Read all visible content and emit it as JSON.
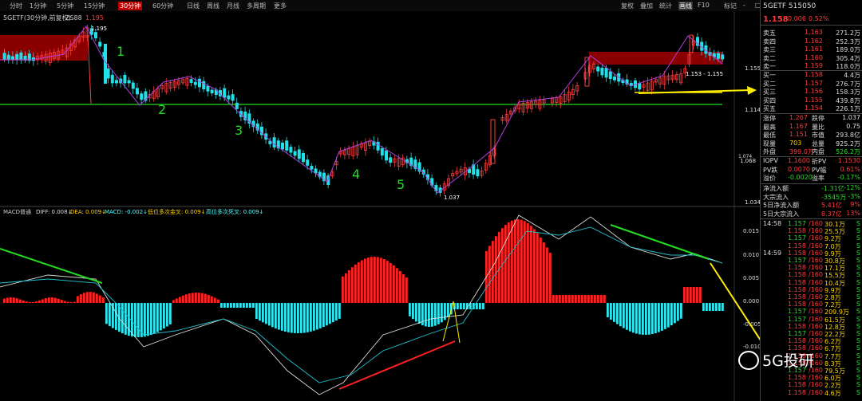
{
  "toolbar": {
    "periods": [
      "分时",
      "1分钟",
      "5分钟",
      "15分钟",
      "30分钟",
      "60分钟",
      "日线",
      "周线",
      "月线",
      "多周期",
      "更多"
    ],
    "active_period": "30分钟",
    "right_items": [
      "复权",
      "叠加",
      "统计",
      "画线",
      "F10",
      "标记",
      "-",
      "□"
    ],
    "right_active": "画线"
  },
  "chart": {
    "title": "5GETF(30分钟,前复权)",
    "indicator": "ZS88",
    "title_value": "1.195",
    "price_labels": {
      "high": "1.195",
      "low": "1.037",
      "range": "1.153 - 1.155",
      "axis_1": "1.155",
      "axis_2": "1.114",
      "axis_3": "1.074",
      "axis_4": "1.068",
      "axis_5": "1.034"
    },
    "wave_labels": [
      "1",
      "2",
      "3",
      "4",
      "5"
    ],
    "macd_header": {
      "name": "MACD普通",
      "diff": "DIFF: 0.008↓",
      "dea": "DEA: 0.009↓",
      "macd": "MACD: -0.002↓",
      "l1": "低位多次金叉: 0.009↓",
      "l2": "高位多次死叉: 0.009↓"
    },
    "macd_axis": [
      "0.015",
      "0.010",
      "0.005",
      "0.000",
      "-0.005",
      "-0.010"
    ]
  },
  "quote": {
    "code": "5GETF 515050",
    "price": "1.158",
    "change": "0.006",
    "pct": "0.52%",
    "asks": [
      {
        "label": "卖五",
        "price": "1.163",
        "vol": "271.2万"
      },
      {
        "label": "卖四",
        "price": "1.162",
        "vol": "252.3万"
      },
      {
        "label": "卖三",
        "price": "1.161",
        "vol": "189.0万"
      },
      {
        "label": "卖二",
        "price": "1.160",
        "vol": "305.4万"
      },
      {
        "label": "卖一",
        "price": "1.159",
        "vol": "118.0万"
      }
    ],
    "bids": [
      {
        "label": "买一",
        "price": "1.158",
        "vol": "4.4万"
      },
      {
        "label": "买二",
        "price": "1.157",
        "vol": "276.7万"
      },
      {
        "label": "买三",
        "price": "1.156",
        "vol": "158.3万"
      },
      {
        "label": "买四",
        "price": "1.155",
        "vol": "439.8万"
      },
      {
        "label": "买五",
        "price": "1.154",
        "vol": "226.1万"
      }
    ],
    "stats": [
      {
        "l1": "涨停",
        "v1": "1.267",
        "l2": "跌停",
        "v2": "1.037"
      },
      {
        "l1": "最高",
        "v1": "1.167",
        "l2": "量比",
        "v2": "0.75"
      },
      {
        "l1": "最低",
        "v1": "1.151",
        "l2": "市值",
        "v2": "293.8亿"
      },
      {
        "l1": "现量",
        "v1": "703",
        "l2": "总量",
        "v2": "925.2万"
      },
      {
        "l1": "外盘",
        "v1": "399.0万",
        "l2": "内盘",
        "v2": "526.2万"
      }
    ],
    "iopv": [
      {
        "l1": "IOPV",
        "v1": "1.1600",
        "l2": "折PV",
        "v2": "1.1530"
      },
      {
        "l1": "PV跌",
        "v1": "0.0070",
        "l2": "PV幅",
        "v2": "0.61%"
      },
      {
        "l1": "溢价",
        "v1": "-0.0020",
        "l2": "溢率",
        "v2": "-0.17%"
      }
    ],
    "flows": [
      {
        "l": "净流入额",
        "v": "-1.31亿",
        "p": "-12%"
      },
      {
        "l": "大宗流入",
        "v": "-3545万",
        "p": "-3%"
      },
      {
        "l": "5日净流入额",
        "v": "5.41亿",
        "p": "9%"
      },
      {
        "l": "5日大宗流入",
        "v": "8.37亿",
        "p": "13%"
      }
    ],
    "ticks": [
      {
        "t": "14:58",
        "p": "1.157",
        "i": "/160",
        "v": "30.1万",
        "s": "S"
      },
      {
        "t": "",
        "p": "1.158",
        "i": "/160",
        "v": "25.5万",
        "s": "S"
      },
      {
        "t": "",
        "p": "1.157",
        "i": "/160",
        "v": "9.2万",
        "s": "S"
      },
      {
        "t": "",
        "p": "1.158",
        "i": "/160",
        "v": "7.0万",
        "s": "S"
      },
      {
        "t": "14:59",
        "p": "1.158",
        "i": "/160",
        "v": "9.9万",
        "s": "S"
      },
      {
        "t": "",
        "p": "1.157",
        "i": "/160",
        "v": "30.8万",
        "s": "S"
      },
      {
        "t": "",
        "p": "1.158",
        "i": "/160",
        "v": "17.1万",
        "s": "S"
      },
      {
        "t": "",
        "p": "1.158",
        "i": "/160",
        "v": "15.5万",
        "s": "S"
      },
      {
        "t": "",
        "p": "1.158",
        "i": "/160",
        "v": "10.4万",
        "s": "S"
      },
      {
        "t": "",
        "p": "1.158",
        "i": "/160",
        "v": "9.9万",
        "s": "S"
      },
      {
        "t": "",
        "p": "1.158",
        "i": "/160",
        "v": "2.8万",
        "s": "S"
      },
      {
        "t": "",
        "p": "1.158",
        "i": "/160",
        "v": "7.2万",
        "s": "S"
      },
      {
        "t": "",
        "p": "1.157",
        "i": "/160",
        "v": "209.9万",
        "s": "S"
      },
      {
        "t": "",
        "p": "1.157",
        "i": "/160",
        "v": "61.5万",
        "s": "S"
      },
      {
        "t": "",
        "p": "1.158",
        "i": "/160",
        "v": "12.8万",
        "s": "S"
      },
      {
        "t": "",
        "p": "1.157",
        "i": "/160",
        "v": "22.2万",
        "s": "S"
      },
      {
        "t": "",
        "p": "1.158",
        "i": "/160",
        "v": "6.2万",
        "s": "S"
      },
      {
        "t": "",
        "p": "1.158",
        "i": "/160",
        "v": "6.7万",
        "s": "S"
      },
      {
        "t": "",
        "p": "1.158",
        "i": "/160",
        "v": "7.7万",
        "s": "S"
      },
      {
        "t": "",
        "p": "1.158",
        "i": "/160",
        "v": "8.3万",
        "s": "S"
      },
      {
        "t": "",
        "p": "1.157",
        "i": "/160",
        "v": "79.5万",
        "s": "S"
      },
      {
        "t": "",
        "p": "1.158",
        "i": "/160",
        "v": "6.0万",
        "s": "S"
      },
      {
        "t": "",
        "p": "1.158",
        "i": "/160",
        "v": "2.2万",
        "s": "S"
      },
      {
        "t": "",
        "p": "1.158",
        "i": "/160",
        "v": "4.6万",
        "s": "S"
      }
    ]
  },
  "watermark": "5G投研",
  "colors": {
    "up": "#ff3b3b",
    "down": "#22e0e8",
    "ma": "#ffffff",
    "dea": "#22c0d0",
    "trend": "#22dd22",
    "arrow": "#ffee00",
    "zone": "#8a0000",
    "wave": "#b040e0"
  }
}
